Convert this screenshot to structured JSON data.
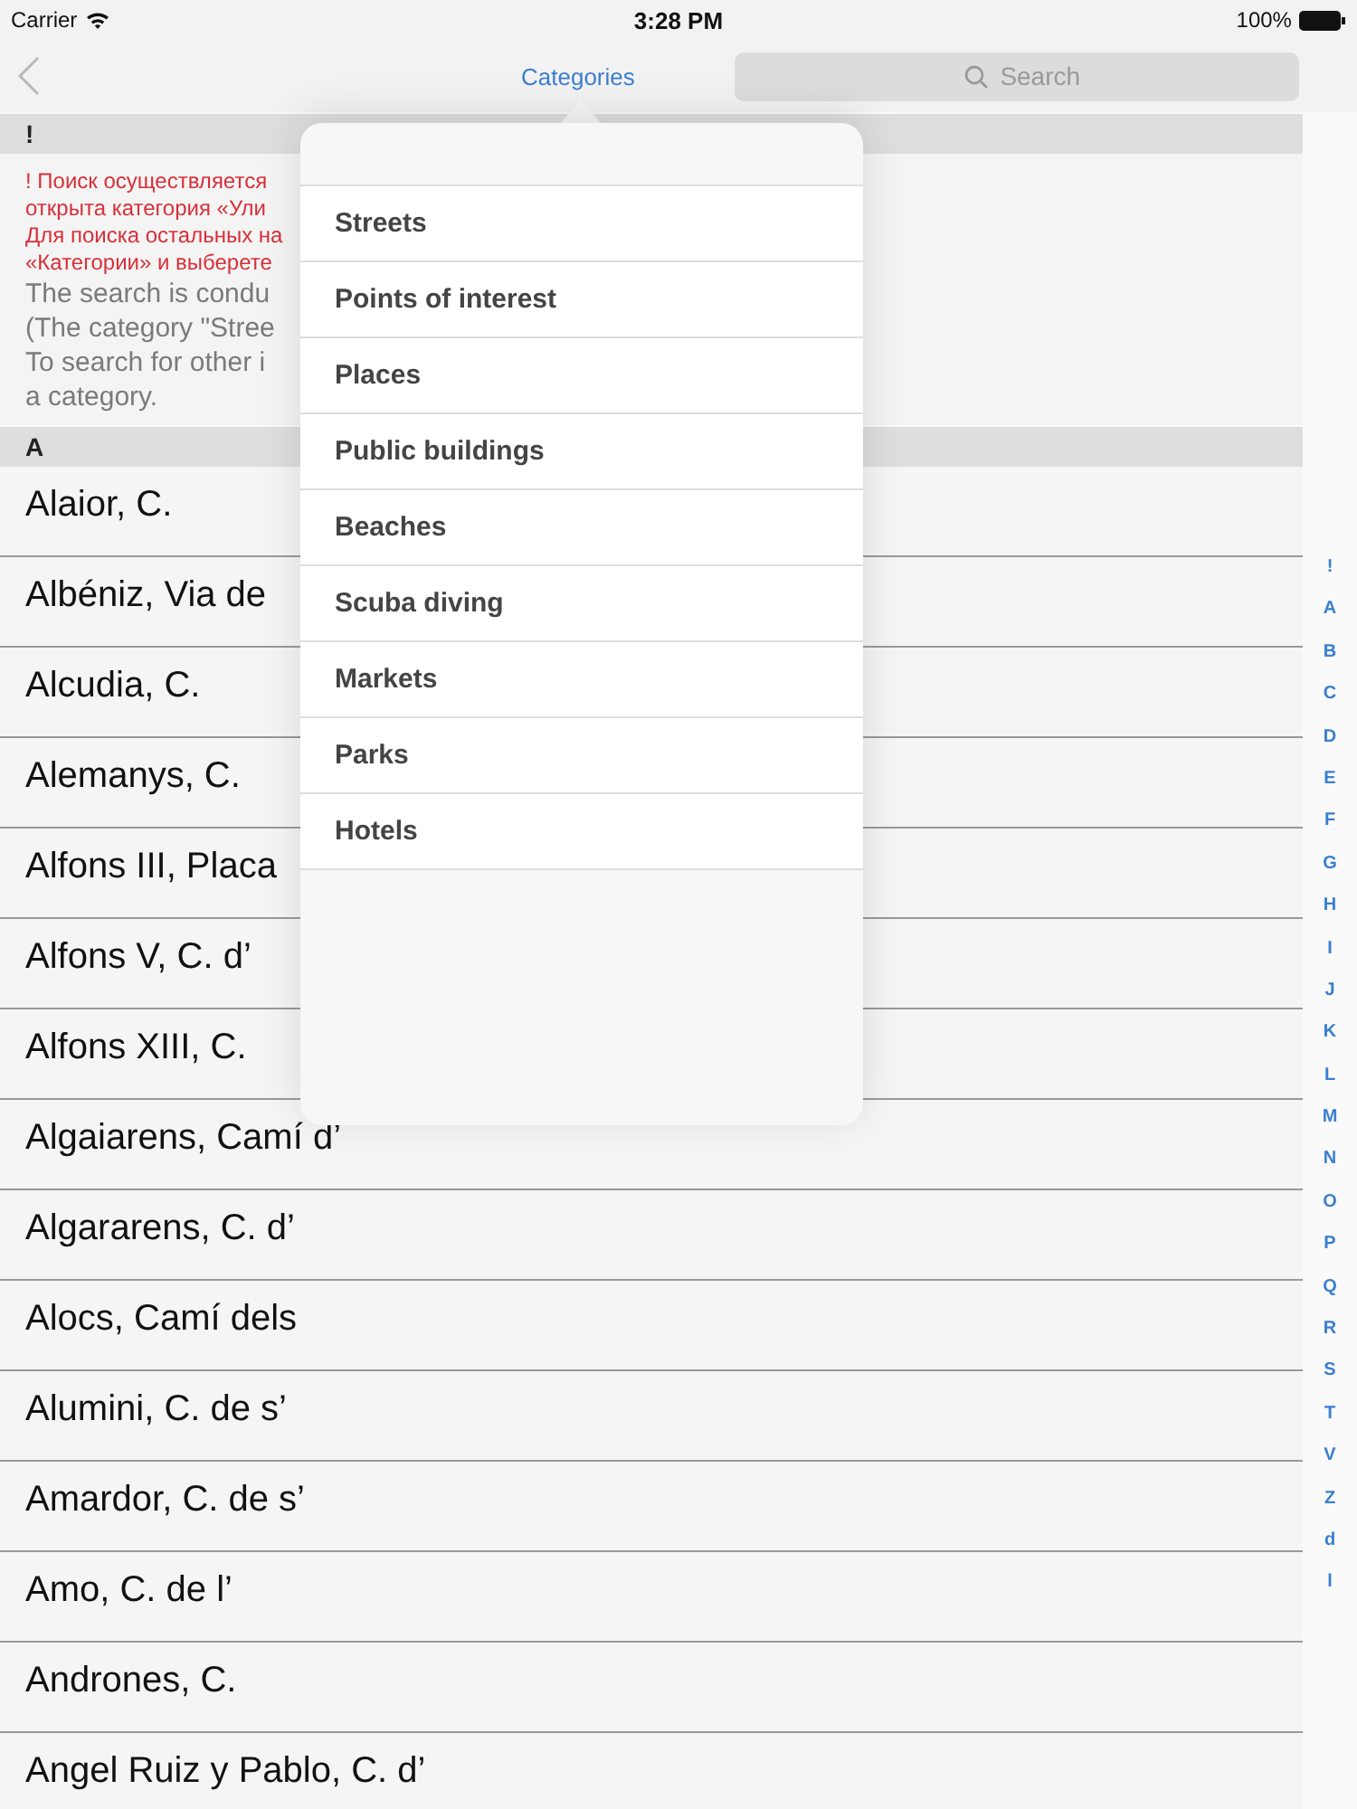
{
  "status_bar": {
    "carrier": "Carrier",
    "time": "3:28 PM",
    "battery": "100%"
  },
  "nav": {
    "title": "Categories",
    "search": {
      "placeholder": "Search"
    }
  },
  "sections": [
    {
      "header": "!",
      "notice": {
        "red_lines": [
          "! Поиск осуществляется",
          "открыта категория «Ули",
          "Для поиска остальных на",
          "«Категории» и выберете"
        ],
        "gray_lines": [
          "The search is condu",
          "(The category \"Stree",
          "To search for other i",
          "a category."
        ]
      }
    },
    {
      "header": "A",
      "rows": [
        "Alaior, C.",
        "Albéniz, Via de",
        "Alcudia, C.",
        "Alemanys, C.",
        "Alfons III, Placa",
        "Alfons V, C. d’",
        "Alfons XIII, C.",
        "Algaiarens, Camí d’",
        "Algararens, C. d’",
        "Alocs,  Camí dels",
        "Alumini, C. de s’",
        "Amardor, C. de s’",
        "Amo, C. de l’",
        "Andrones, C.",
        "Angel Ruiz y Pablo, C. d’"
      ]
    }
  ],
  "index": [
    "!",
    "A",
    "B",
    "C",
    "D",
    "E",
    "F",
    "G",
    "H",
    "I",
    "J",
    "K",
    "L",
    "M",
    "N",
    "O",
    "P",
    "Q",
    "R",
    "S",
    "T",
    "V",
    "Z",
    "d",
    "l"
  ],
  "popover": {
    "items": [
      "Streets",
      "Points of interest",
      "Places",
      "Public buildings",
      "Beaches",
      "Scuba diving",
      "Markets",
      "Parks",
      "Hotels"
    ]
  }
}
